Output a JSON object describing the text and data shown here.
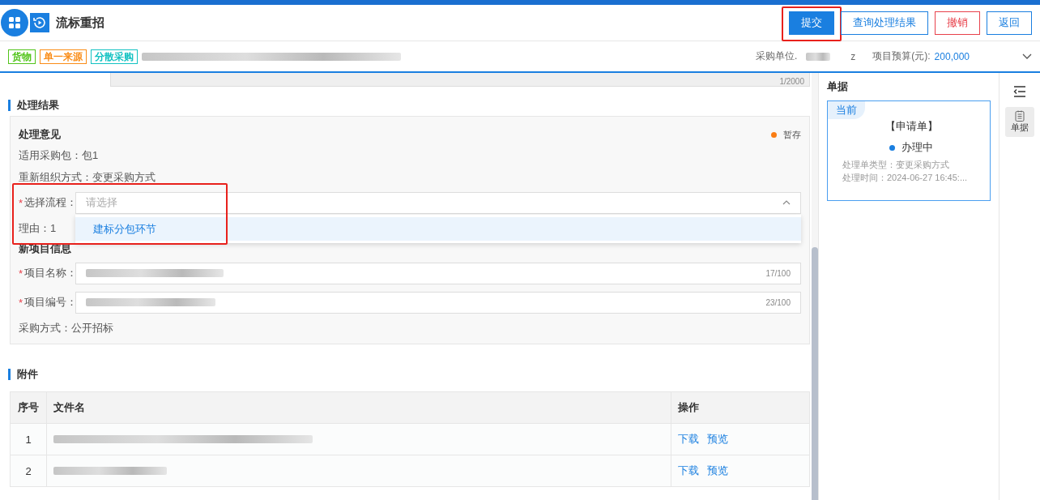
{
  "header": {
    "title": "流标重招",
    "buttons": [
      {
        "label": "提交",
        "kind": "primary",
        "highlighted": true
      },
      {
        "label": "查询处理结果",
        "kind": "outline",
        "highlighted": false
      },
      {
        "label": "撤销",
        "kind": "danger",
        "highlighted": false
      },
      {
        "label": "返回",
        "kind": "outline",
        "highlighted": false
      }
    ]
  },
  "tags": [
    {
      "label": "货物",
      "color": "#52c41a"
    },
    {
      "label": "单一来源",
      "color": "#fa8c16"
    },
    {
      "label": "分散采购",
      "color": "#13c2c2"
    }
  ],
  "summary": {
    "unit_label": "采购单位.",
    "unit_suffix": "z",
    "budget_label": "项目预算(元):",
    "budget_value": "200,000"
  },
  "textarea_counter": "1/2000",
  "result": {
    "title": "处理结果",
    "card_title": "处理意见",
    "status": "暂存",
    "fields": [
      {
        "kind": "text",
        "text": "适用采购包：包1"
      },
      {
        "kind": "text",
        "text": "重新组织方式：变更采购方式"
      },
      {
        "kind": "select",
        "label": "选择流程：",
        "marker": "*",
        "placeholder": "请选择",
        "expanded": true,
        "highlighted": true,
        "options": [
          {
            "label": "建标分包环节",
            "selected": true
          }
        ]
      },
      {
        "kind": "text",
        "text": "理由：1"
      },
      {
        "kind": "heading",
        "text": "新项目信息"
      },
      {
        "kind": "input",
        "label": "项目名称：",
        "marker": "*",
        "counter": "17/100"
      },
      {
        "kind": "input",
        "label": "项目编号：",
        "marker": "*",
        "counter": "23/100"
      },
      {
        "kind": "text",
        "text": "采购方式：公开招标"
      }
    ]
  },
  "attachments": {
    "title": "附件",
    "columns": [
      "序号",
      "文件名",
      "操作"
    ],
    "rows": [
      {
        "index": "1",
        "actions": [
          "下载",
          "预览"
        ]
      },
      {
        "index": "2",
        "actions": [
          "下载",
          "预览"
        ]
      }
    ]
  },
  "documents": {
    "title": "单据",
    "card": {
      "badge": "当前",
      "name": "【申请单】",
      "status": "办理中",
      "lines": [
        "处理单类型：变更采购方式",
        "处理时间：2024-06-27 16:45:..."
      ]
    }
  },
  "rail": {
    "tabs": [
      {
        "label": "单据",
        "selected": true
      }
    ]
  }
}
